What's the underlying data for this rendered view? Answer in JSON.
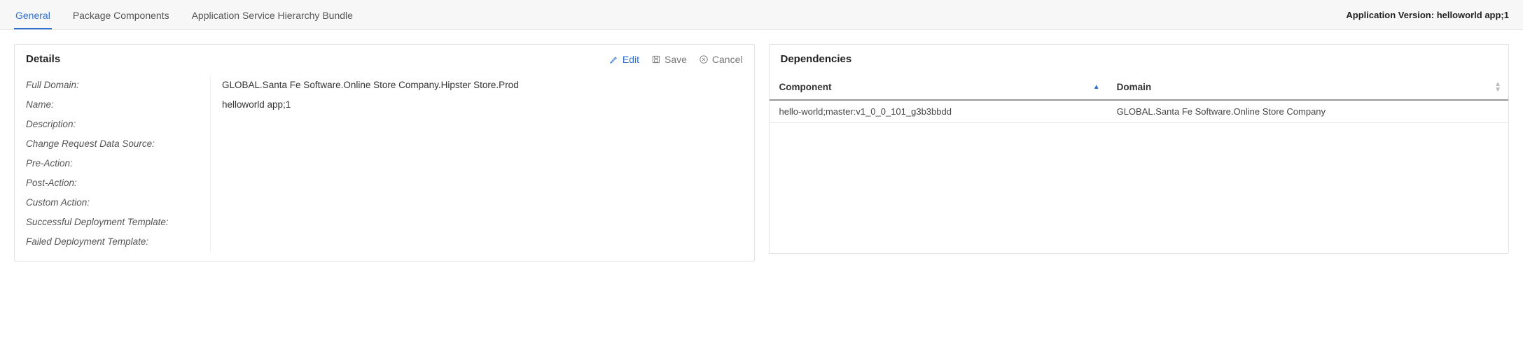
{
  "tabs": {
    "general": "General",
    "package_components": "Package Components",
    "service_hierarchy": "Application Service Hierarchy Bundle"
  },
  "version_label": "Application Version:",
  "version_value": "helloworld app;1",
  "details": {
    "title": "Details",
    "actions": {
      "edit": "Edit",
      "save": "Save",
      "cancel": "Cancel"
    },
    "rows": [
      {
        "label": "Full Domain:",
        "value": "GLOBAL.Santa Fe Software.Online Store Company.Hipster Store.Prod"
      },
      {
        "label": "Name:",
        "value": "helloworld app;1"
      },
      {
        "label": "Description:",
        "value": ""
      },
      {
        "label": "Change Request Data Source:",
        "value": ""
      },
      {
        "label": "Pre-Action:",
        "value": ""
      },
      {
        "label": "Post-Action:",
        "value": ""
      },
      {
        "label": "Custom Action:",
        "value": ""
      },
      {
        "label": "Successful Deployment Template:",
        "value": ""
      },
      {
        "label": "Failed Deployment Template:",
        "value": ""
      }
    ]
  },
  "dependencies": {
    "title": "Dependencies",
    "columns": {
      "component": "Component",
      "domain": "Domain"
    },
    "rows": [
      {
        "component": "hello-world;master:v1_0_0_101_g3b3bbdd",
        "domain": "GLOBAL.Santa Fe Software.Online Store Company"
      }
    ]
  }
}
